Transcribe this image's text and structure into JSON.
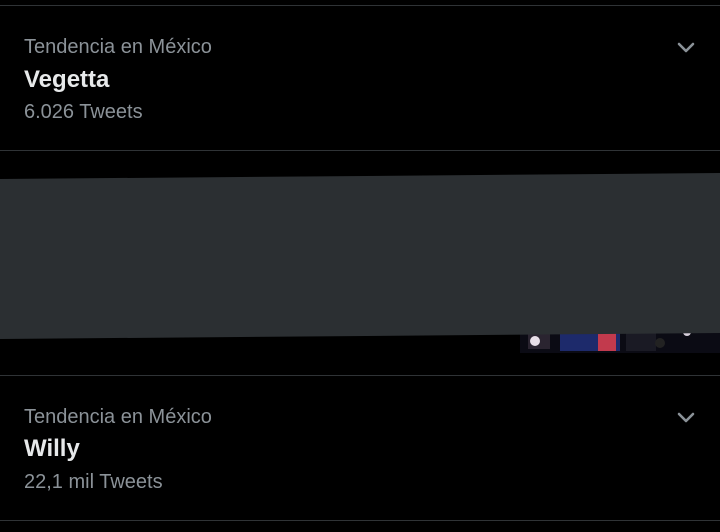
{
  "trends": [
    {
      "context": "Tendencia en México",
      "name": "Vegetta",
      "count": "6.026 Tweets",
      "menu_icon": "chevron-down-icon"
    },
    {
      "context": "Tendencia en México",
      "name": "Willy",
      "count": "22,1 mil Tweets",
      "menu_icon": "chevron-down-icon"
    }
  ],
  "colors": {
    "background": "#000000",
    "primary_text": "#e7e9ea",
    "secondary_text": "#8b9298",
    "divider": "#2f3336",
    "redaction": "#2b2f32"
  }
}
